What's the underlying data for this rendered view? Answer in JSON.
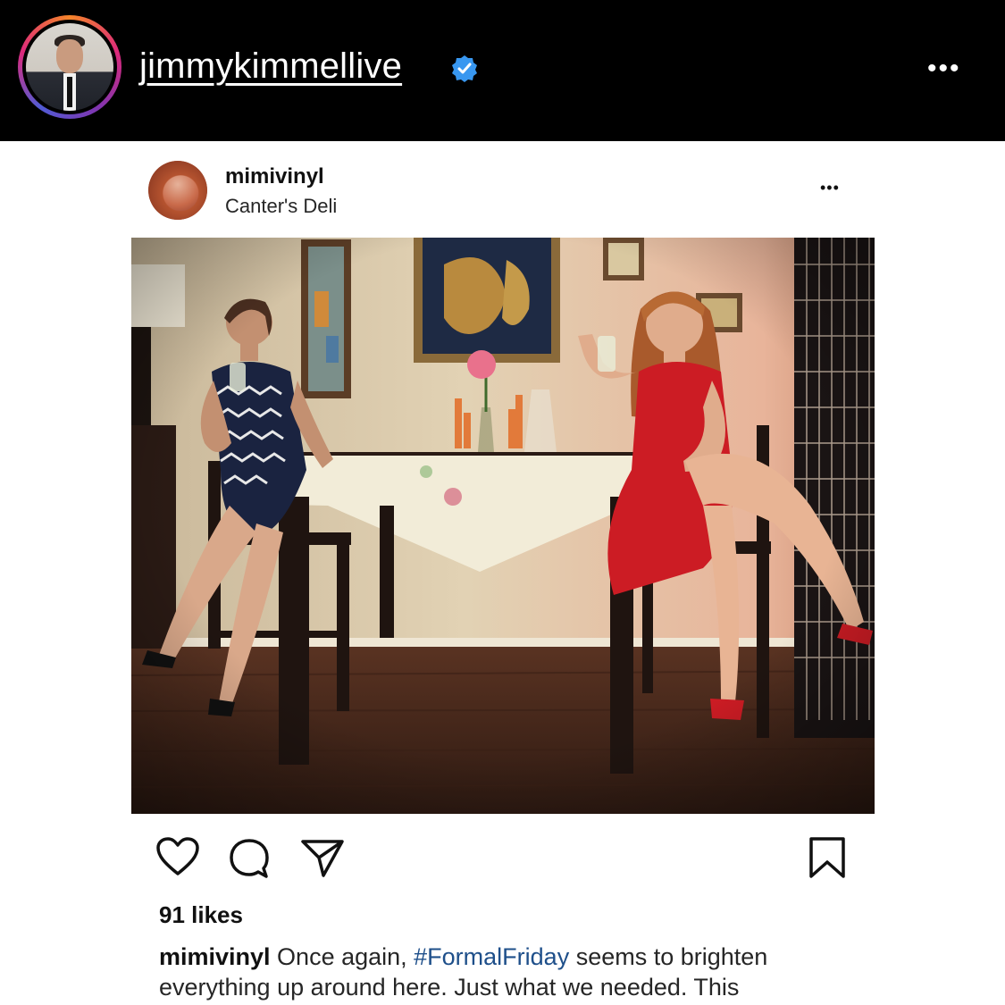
{
  "header": {
    "account_name": "jimmykimmellive",
    "more_label": "•••"
  },
  "post": {
    "username": "mimivinyl",
    "location": "Canter's Deli",
    "more_label": "•••",
    "likes": "91 likes",
    "caption": {
      "username": "mimivinyl",
      "text_before": " Once again, ",
      "hashtag": "#FormalFriday",
      "text_after": " seems to brighten everything up around here. Just what we needed. This"
    }
  },
  "icons": {
    "verified": "verified-badge-icon",
    "like": "heart-icon",
    "comment": "comment-bubble-icon",
    "share": "paper-plane-icon",
    "save": "bookmark-icon"
  },
  "colors": {
    "header_bg": "#000000",
    "verified_blue": "#3897f0",
    "hashtag": "#1e4f8a"
  }
}
